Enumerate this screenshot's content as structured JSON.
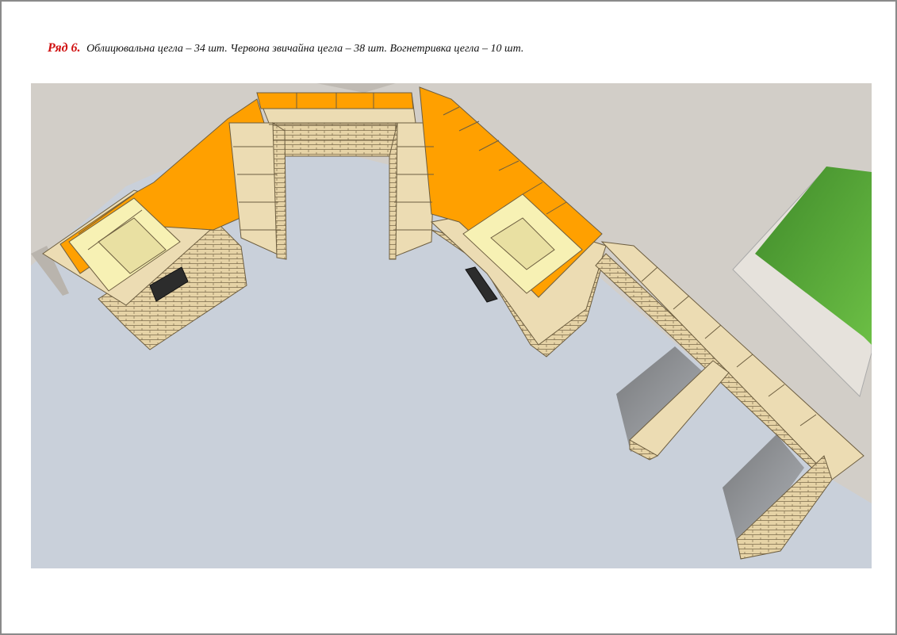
{
  "caption": {
    "row_label": "Ряд 6.",
    "text": "Облицювальна цегла – 34 шт. Червона звичайна цегла – 38 шт. Вогнетривка цегла – 10 шт."
  },
  "colors": {
    "frame_border": "#8a8a8a",
    "row_label": "#d01010",
    "floor": "#c9d0da",
    "pavement": "#cfcbc5",
    "facing_brick": "#ecdcb3",
    "red_brick_marked": "#ffa000",
    "firebrick": "#f7f1b4",
    "grass": "#5aa53a",
    "grate": "#2c2c2c"
  },
  "icons": [
    "ash-door-grate-left",
    "ash-door-grate-right"
  ]
}
